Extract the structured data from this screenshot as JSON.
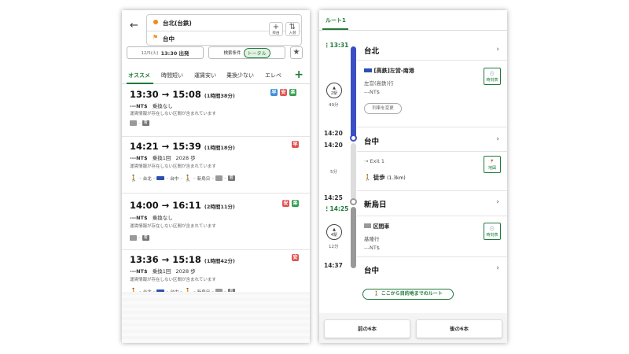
{
  "left": {
    "origin": "台北(台鉄)",
    "destination": "台中",
    "btn_via_symbol": "+",
    "btn_via": "経由",
    "btn_swap_symbol": "⇅",
    "btn_swap": "入替",
    "depart": "12/5(火) 13:30 出発",
    "depart_date": "12/5(火)",
    "depart_time": "13:30 出発",
    "search_cond": "検索条件",
    "total": "トータル",
    "tabs": [
      "オススメ",
      "時間短い",
      "運賃安い",
      "乗換少ない",
      "エレベ"
    ],
    "routes": [
      {
        "time": "13:30 → 15:08",
        "dur": "(1時間38分)",
        "fare": "---NT$",
        "transfer": "乗換なし",
        "steps": "",
        "note": "運賃情報が存在しない区間が含まれています",
        "badges": [
          "早",
          "安",
          "楽"
        ]
      },
      {
        "time": "14:21 → 15:39",
        "dur": "(1時間18分)",
        "fare": "---NT$",
        "transfer": "乗換1回",
        "steps": "2028 歩",
        "note": "運賃情報が存在しない区間が含まれています",
        "badges": [
          "早"
        ]
      },
      {
        "time": "14:00 → 16:11",
        "dur": "(2時間11分)",
        "fare": "---NT$",
        "transfer": "乗換なし",
        "steps": "",
        "note": "運賃情報が存在しない区間が含まれています",
        "badges": [
          "安",
          "楽"
        ]
      },
      {
        "time": "13:36 → 15:18",
        "dur": "(1時間42分)",
        "fare": "---NT$",
        "transfer": "乗換1回",
        "steps": "2028 歩",
        "note": "運賃情報が存在しない区間が含まれています",
        "badges": [
          "安"
        ]
      }
    ],
    "route2_icons": [
      "台北",
      "台中",
      "新烏日"
    ],
    "route4_icons": [
      "台北",
      "台中",
      "新烏日"
    ],
    "icon_gray": "着"
  },
  "right": {
    "tab": "ルート1",
    "t1": "13:31",
    "st1": "台北",
    "train1": "[高鉄]左営-南港",
    "dir1": "左営(高鉄)行",
    "fare1": "---NT$",
    "change_train": "列車を変更",
    "stops1": "2駅",
    "mins1": "49分",
    "timetable": "時刻表",
    "t2a": "14:20",
    "t2b": "14:20",
    "st2": "台中",
    "exit": "Exit 1",
    "walk": "徒歩",
    "walk_dist": "(1.3km)",
    "mins_walk": "5分",
    "map": "地図",
    "t3a": "14:25",
    "t3b": "14:25",
    "st3": "新烏日",
    "train2": "区間車",
    "dir2": "基隆行",
    "fare2": "---NT$",
    "stops2": "4駅",
    "mins2": "12分",
    "t4": "14:37",
    "st4": "台中",
    "route_from_here": "ここから目的地までのルート",
    "prev": "前の6本",
    "next": "後の6本"
  }
}
